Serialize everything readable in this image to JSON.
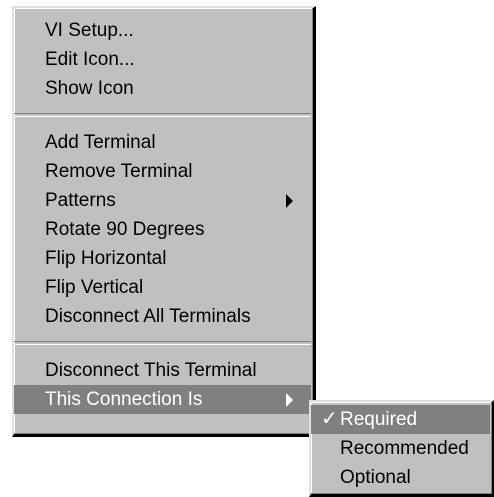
{
  "main_menu": {
    "group1": [
      "VI Setup...",
      "Edit Icon...",
      "Show Icon"
    ],
    "group2": [
      "Add Terminal",
      "Remove Terminal",
      "Patterns",
      "Rotate 90 Degrees",
      "Flip Horizontal",
      "Flip Vertical",
      "Disconnect All Terminals"
    ],
    "group3": [
      "Disconnect This Terminal",
      "This Connection Is"
    ]
  },
  "submenu": {
    "checkmark": "✓",
    "items": [
      "Required",
      "Recommended",
      "Optional"
    ],
    "checked": "Required"
  },
  "colors": {
    "menu_bg": "#c0c0c0",
    "highlight_bg": "#808080",
    "highlight_text": "#ffffff",
    "text": "#000000"
  },
  "icons": [
    "submenu-arrow-icon",
    "checkmark-icon"
  ]
}
